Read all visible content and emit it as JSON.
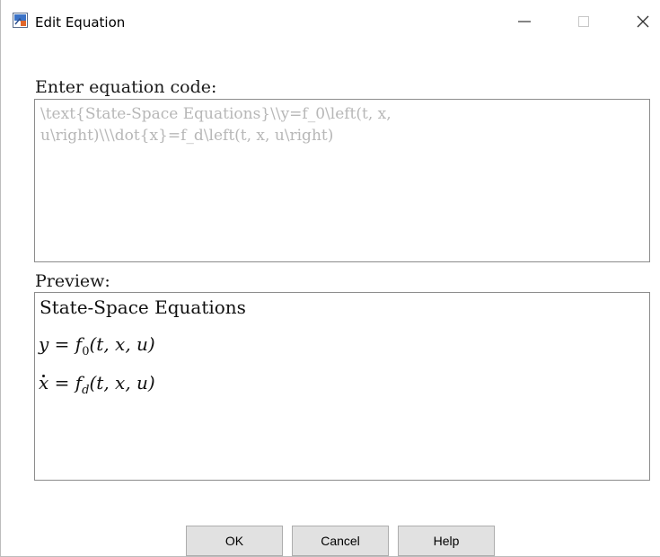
{
  "window": {
    "title": "Edit Equation",
    "controls": {
      "minimize_icon": "minimize-icon",
      "maximize_icon": "maximize-icon",
      "close_icon": "close-icon"
    }
  },
  "editor": {
    "label": "Enter equation code:",
    "code": "\\text{State-Space Equations}\\\\y=f_0\\left(t, x,\nu\\right)\\\\\\dot{x}=f_d\\left(t, x, u\\right)"
  },
  "preview": {
    "label": "Preview:",
    "title": "State-Space Equations",
    "eq1": {
      "lhs": "y",
      "equals": " = ",
      "fn": "f",
      "sub": "0",
      "args": "(t, x, u)"
    },
    "eq2": {
      "lhs": "x",
      "equals": " = ",
      "fn": "f",
      "sub": "d",
      "args": "(t, x, u)"
    }
  },
  "buttons": {
    "ok": "OK",
    "cancel": "Cancel",
    "help": "Help"
  },
  "colors": {
    "placeholder_text": "#b7b7b7",
    "button_face": "#e1e1e1",
    "border": "#8c8c8c"
  }
}
